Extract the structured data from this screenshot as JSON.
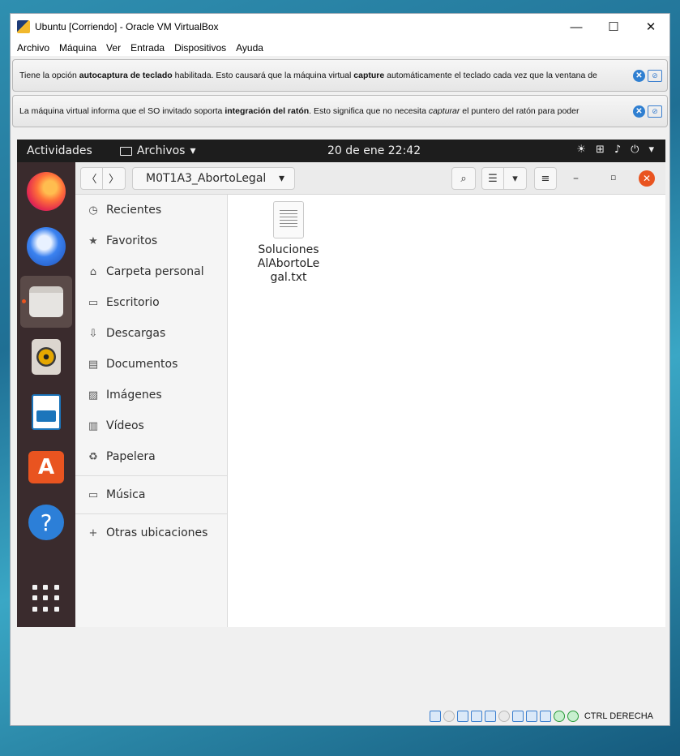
{
  "window": {
    "title": "Ubuntu [Corriendo] - Oracle VM VirtualBox",
    "controls": {
      "minimize": "—",
      "maximize": "☐",
      "close": "✕"
    }
  },
  "menu": [
    "Archivo",
    "Máquina",
    "Ver",
    "Entrada",
    "Dispositivos",
    "Ayuda"
  ],
  "notices": {
    "keyboard": {
      "t1": "Tiene la opción ",
      "b1": "autocaptura de teclado",
      "t2": " habilitada. Esto causará que la máquina virtual ",
      "b2": "capture",
      "t3": " automáticamente el teclado cada vez que la ventana de"
    },
    "mouse": {
      "t1": "La máquina virtual informa que el SO invitado soporta ",
      "b1": "integración del ratón",
      "t2": ". Esto significa que no necesita ",
      "i1": "capturar",
      "t3": " el puntero del ratón para poder"
    }
  },
  "ubuntu": {
    "activities": "Actividades",
    "app_menu": "Archivos",
    "clock": "20 de ene  22:42"
  },
  "dock": [
    "firefox",
    "thunderbird",
    "files",
    "rhythmbox",
    "libreoffice-writer",
    "ubuntu-software",
    "help",
    "show-applications"
  ],
  "files": {
    "path": "M0T1A3_AbortoLegal",
    "sidebar": [
      {
        "label": "Recientes",
        "icon": "clock-icon"
      },
      {
        "label": "Favoritos",
        "icon": "star-icon"
      },
      {
        "label": "Carpeta personal",
        "icon": "home-icon"
      },
      {
        "label": "Escritorio",
        "icon": "desktop-icon"
      },
      {
        "label": "Descargas",
        "icon": "download-icon"
      },
      {
        "label": "Documentos",
        "icon": "document-icon"
      },
      {
        "label": "Imágenes",
        "icon": "image-icon"
      },
      {
        "label": "Vídeos",
        "icon": "video-icon"
      },
      {
        "label": "Papelera",
        "icon": "trash-icon"
      }
    ],
    "sidebar_extra": [
      {
        "label": "Música",
        "icon": "folder-icon"
      },
      {
        "label": "Otras ubicaciones",
        "icon": "plus-icon"
      }
    ],
    "items": [
      {
        "name": "SolucionesAlAbortoLegal.txt",
        "display": "Soluciones\nAlAbortoLe\ngal.txt"
      }
    ]
  },
  "statusbar": {
    "host_key": "CTRL DERECHA"
  }
}
